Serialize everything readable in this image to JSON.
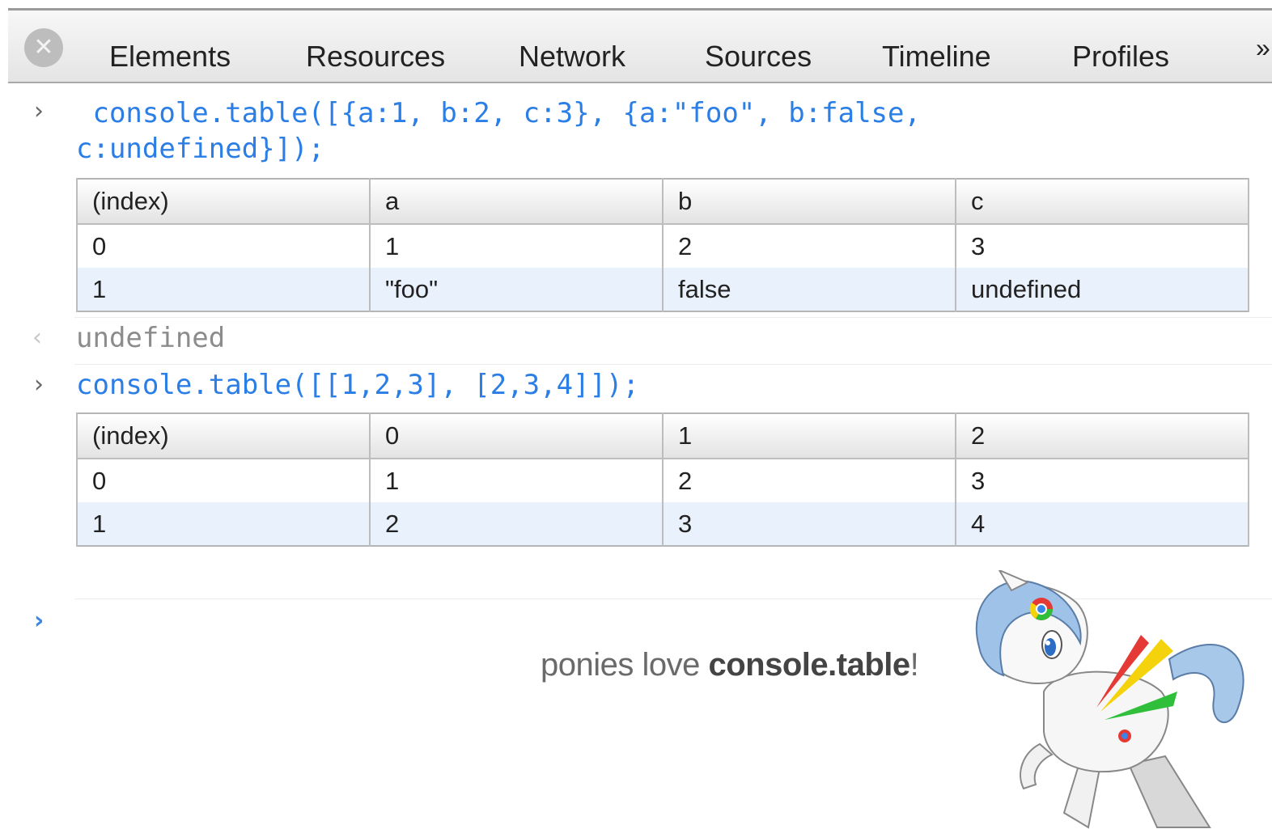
{
  "toolbar": {
    "close_glyph": "✕",
    "tabs": [
      "Elements",
      "Resources",
      "Network",
      "Sources",
      "Timeline",
      "Profiles"
    ],
    "more_glyph": "»"
  },
  "console": {
    "prompt_glyph": "›",
    "result_glyph": "‹",
    "entries": [
      {
        "command_line1": " console.table([{a:1, b:2, c:3}, {a:\"foo\", b:false,",
        "command_line2": "c:undefined}]);",
        "table": {
          "headers": [
            "(index)",
            "a",
            "b",
            "c"
          ],
          "rows": [
            [
              "0",
              "1",
              "2",
              "3"
            ],
            [
              "1",
              "\"foo\"",
              "false",
              "undefined"
            ]
          ]
        },
        "result": "undefined"
      },
      {
        "command_line1": "console.table([[1,2,3], [2,3,4]]);",
        "table": {
          "headers": [
            "(index)",
            "0",
            "1",
            "2"
          ],
          "rows": [
            [
              "0",
              "1",
              "2",
              "3"
            ],
            [
              "1",
              "2",
              "3",
              "4"
            ]
          ]
        }
      }
    ]
  },
  "caption": {
    "prefix": "ponies love ",
    "emphasis": "console.table",
    "suffix": "!"
  },
  "colors": {
    "code_blue": "#2a7ee6",
    "row_highlight": "#e9f1fc",
    "chrome_red": "#e53935",
    "chrome_yellow": "#f4d20c",
    "chrome_green": "#2fbf3a",
    "pony_mane": "#9fc3e8"
  }
}
